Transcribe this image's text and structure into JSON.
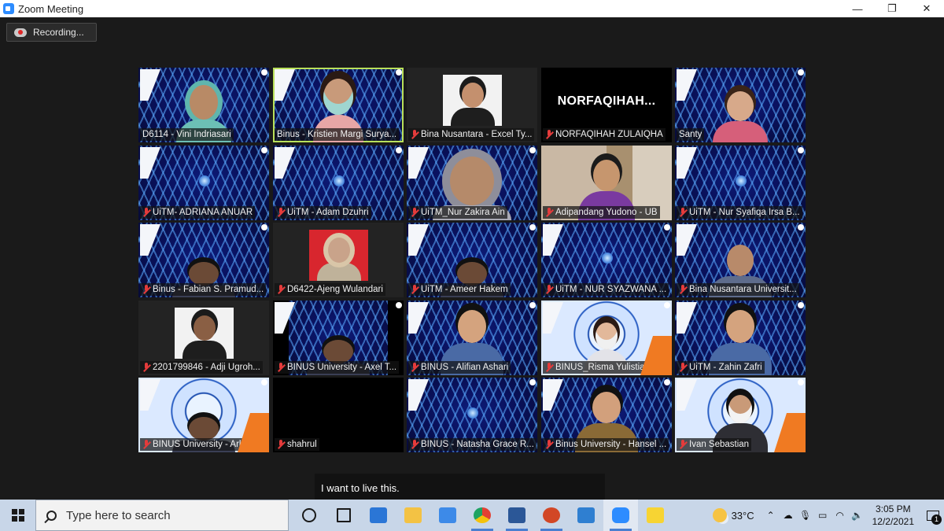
{
  "window": {
    "title": "Zoom Meeting",
    "controls": {
      "minimize": "—",
      "restore": "❐",
      "close": "✕"
    }
  },
  "recording": {
    "label": "Recording..."
  },
  "participants": [
    {
      "name": "D6114 - Vini Indriasari",
      "muted": false,
      "bg": "tunnel",
      "avatar": "woman-hijab"
    },
    {
      "name": "Binus - Kristien Margi Surya...",
      "muted": false,
      "bg": "tunnel",
      "avatar": "woman-mask",
      "active_speaker": true
    },
    {
      "name": "Bina Nusantara - Excel Ty...",
      "muted": true,
      "bg": "dark",
      "avatar": "photo-person"
    },
    {
      "name": "NORFAQIHAH ZULAIQHA",
      "muted": true,
      "bg": "black",
      "display_text": "NORFAQIHAH..."
    },
    {
      "name": "Santy",
      "muted": false,
      "bg": "tunnel",
      "avatar": "woman-glasses"
    },
    {
      "name": "UiTM- ADRIANA ANUAR",
      "muted": true,
      "bg": "tunnel",
      "avatar": "none"
    },
    {
      "name": "UiTM - Adam Dzuhri",
      "muted": true,
      "bg": "tunnel",
      "avatar": "none"
    },
    {
      "name": "UiTM_Nur Zakira Ain",
      "muted": true,
      "bg": "tunnel",
      "avatar": "woman-hijab-close"
    },
    {
      "name": "Adipandang Yudono - UB",
      "muted": true,
      "bg": "room",
      "avatar": "man-glasses"
    },
    {
      "name": "UiTM - Nur Syafiqa Irsa B...",
      "muted": true,
      "bg": "tunnel",
      "avatar": "none"
    },
    {
      "name": "Binus - Fabian S. Pramud...",
      "muted": true,
      "bg": "tunnel",
      "avatar": "man-bottom"
    },
    {
      "name": "D6422-Ajeng Wulandari",
      "muted": true,
      "bg": "dark",
      "avatar": "photo-red"
    },
    {
      "name": "UiTM - Ameer Hakem",
      "muted": true,
      "bg": "tunnel",
      "avatar": "man-bottom"
    },
    {
      "name": "UiTM - NUR SYAZWANA ...",
      "muted": true,
      "bg": "tunnel",
      "avatar": "none"
    },
    {
      "name": "Bina Nusantara Universit...",
      "muted": true,
      "bg": "tunnel",
      "avatar": "man-bald"
    },
    {
      "name": "2201799846 - Adji Ugroh...",
      "muted": true,
      "bg": "dark",
      "avatar": "photo-man"
    },
    {
      "name": "BINUS University - Axel T...",
      "muted": true,
      "bg": "tunnel-black",
      "avatar": "man-bottom"
    },
    {
      "name": "BINUS - Alifian Ashari",
      "muted": true,
      "bg": "tunnel",
      "avatar": "man-young"
    },
    {
      "name": "BINUS_Risma Yulistiani",
      "muted": true,
      "bg": "orange",
      "avatar": "woman-mask-small"
    },
    {
      "name": "UiTM - Zahin Zafri",
      "muted": true,
      "bg": "tunnel",
      "avatar": "man-young"
    },
    {
      "name": "BINUS University - Arlexy...",
      "muted": true,
      "bg": "orange",
      "avatar": "man-bottom"
    },
    {
      "name": "shahrul",
      "muted": true,
      "bg": "black",
      "avatar": "none"
    },
    {
      "name": "BINUS - Natasha Grace R...",
      "muted": true,
      "bg": "tunnel",
      "avatar": "none"
    },
    {
      "name": "Binus University - Hansel ...",
      "muted": true,
      "bg": "tunnel",
      "avatar": "man-glasses-young"
    },
    {
      "name": "Ivan Sebastian",
      "muted": true,
      "bg": "orange",
      "avatar": "man-mask"
    }
  ],
  "caption": {
    "text": "I want to live this."
  },
  "taskbar": {
    "search_placeholder": "Type here to search",
    "weather_temp": "33°C",
    "time": "3:05 PM",
    "date": "12/2/2021",
    "notification_count": "1",
    "apps": [
      {
        "icon": "task-view-icon",
        "color": "#1a1a1a"
      },
      {
        "icon": "widgets-icon",
        "color": "#1a1a1a"
      },
      {
        "icon": "mail-icon",
        "color": "#2b76d6"
      },
      {
        "icon": "file-explorer-icon",
        "color": "#f3c244"
      },
      {
        "icon": "store-icon",
        "color": "#3d8ae8"
      },
      {
        "icon": "chrome-icon",
        "color": "#e34133"
      },
      {
        "icon": "word-icon",
        "color": "#2b5797"
      },
      {
        "icon": "powerpoint-icon",
        "color": "#d24726"
      },
      {
        "icon": "photos-icon",
        "color": "#2f7fd1"
      },
      {
        "icon": "zoom-icon",
        "color": "#2d8cff"
      },
      {
        "icon": "sticky-notes-icon",
        "color": "#f7d433"
      }
    ]
  }
}
